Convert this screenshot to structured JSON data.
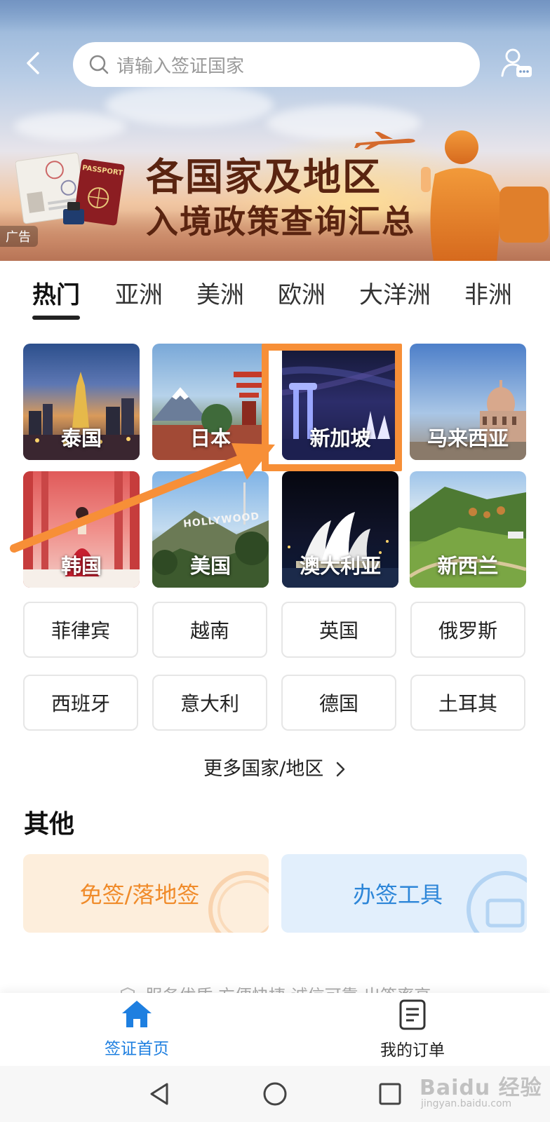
{
  "header": {
    "search_placeholder": "请输入签证国家"
  },
  "banner": {
    "title_line1": "各国家及地区",
    "title_line2": "入境政策查询汇总",
    "ad_tag": "广告",
    "passport_text": "PASSPORT"
  },
  "tabs": [
    {
      "label": "热门",
      "active": true
    },
    {
      "label": "亚洲",
      "active": false
    },
    {
      "label": "美洲",
      "active": false
    },
    {
      "label": "欧洲",
      "active": false
    },
    {
      "label": "大洋洲",
      "active": false
    },
    {
      "label": "非洲",
      "active": false
    }
  ],
  "featured_countries": [
    {
      "label": "泰国"
    },
    {
      "label": "日本"
    },
    {
      "label": "新加坡"
    },
    {
      "label": "马来西亚"
    },
    {
      "label": "韩国"
    },
    {
      "label": "美国",
      "sign_text": "HOLLYWOOD"
    },
    {
      "label": "澳大利亚"
    },
    {
      "label": "新西兰"
    }
  ],
  "countries": [
    {
      "label": "菲律宾"
    },
    {
      "label": "越南"
    },
    {
      "label": "英国"
    },
    {
      "label": "俄罗斯"
    },
    {
      "label": "西班牙"
    },
    {
      "label": "意大利"
    },
    {
      "label": "德国"
    },
    {
      "label": "土耳其"
    }
  ],
  "more_link": "更多国家/地区",
  "other_section": {
    "title": "其他",
    "visa_free": "免签/落地签",
    "tools": "办签工具"
  },
  "slogan": "服务优质·方便快捷·诚信可靠·出签率高",
  "bottom_nav": {
    "home": "签证首页",
    "orders": "我的订单"
  },
  "watermark": {
    "main": "Baidu 经验",
    "sub": "jingyan.baidu.com"
  },
  "colors": {
    "accent_blue": "#1e7fe0",
    "annotation_orange": "#f78f37",
    "visa_free_text": "#f08b2a",
    "tools_text": "#2d86d8"
  }
}
